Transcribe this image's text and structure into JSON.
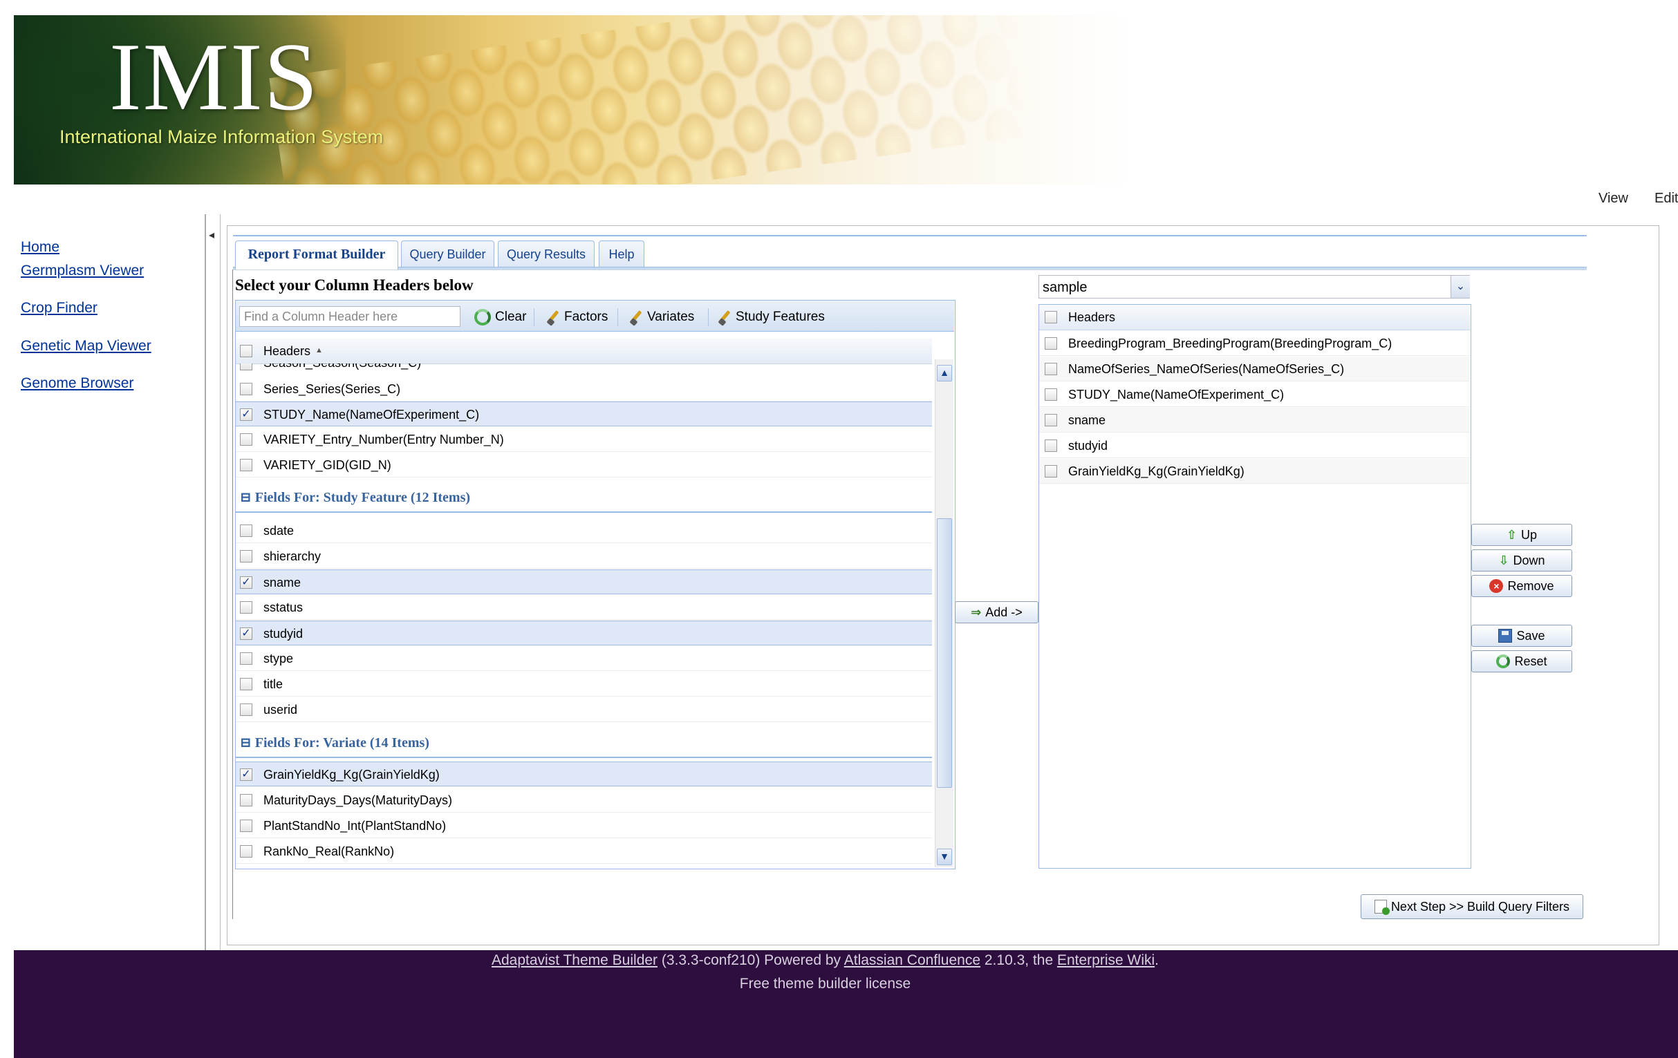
{
  "banner": {
    "title": "IMIS",
    "subtitle": "International Maize Information System"
  },
  "top_links": {
    "view": "View",
    "edit": "Edit"
  },
  "sidebar": {
    "items": [
      {
        "label": "Home"
      },
      {
        "label": "Germplasm Viewer"
      },
      {
        "label": "Crop Finder"
      },
      {
        "label": "Genetic Map Viewer"
      },
      {
        "label": "Genome Browser"
      }
    ]
  },
  "tabs": [
    {
      "label": "Report Format Builder",
      "active": true
    },
    {
      "label": "Query Builder",
      "active": false
    },
    {
      "label": "Query Results",
      "active": false
    },
    {
      "label": "Help",
      "active": false
    }
  ],
  "section_title": "Select your Column Headers below",
  "left_toolbar": {
    "search_placeholder": "Find a Column Header here",
    "clear": "Clear",
    "factors": "Factors",
    "variates": "Variates",
    "study_features": "Study Features"
  },
  "left_grid": {
    "header": "Headers",
    "sort_indicator": "▲",
    "partial_row": "Season_Season(Season_C)",
    "rows_top": [
      {
        "label": "Series_Series(Series_C)",
        "checked": false
      },
      {
        "label": "STUDY_Name(NameOfExperiment_C)",
        "checked": true
      },
      {
        "label": "VARIETY_Entry_Number(Entry Number_N)",
        "checked": false
      },
      {
        "label": "VARIETY_GID(GID_N)",
        "checked": false
      }
    ],
    "group_study": {
      "title": "Fields For: Study Feature (12 Items)",
      "rows": [
        {
          "label": "sdate",
          "checked": false
        },
        {
          "label": "shierarchy",
          "checked": false
        },
        {
          "label": "sname",
          "checked": true
        },
        {
          "label": "sstatus",
          "checked": false
        },
        {
          "label": "studyid",
          "checked": true
        },
        {
          "label": "stype",
          "checked": false
        },
        {
          "label": "title",
          "checked": false
        },
        {
          "label": "userid",
          "checked": false
        }
      ]
    },
    "group_variate": {
      "title": "Fields For: Variate (14 Items)",
      "rows": [
        {
          "label": "GrainYieldKg_Kg(GrainYieldKg)",
          "checked": true
        },
        {
          "label": "MaturityDays_Days(MaturityDays)",
          "checked": false
        },
        {
          "label": "PlantStandNo_Int(PlantStandNo)",
          "checked": false
        },
        {
          "label": "RankNo_Real(RankNo)",
          "checked": false
        }
      ]
    },
    "group_toggle": "⊟"
  },
  "add_button": "Add ->",
  "right_panel": {
    "combo_value": "sample",
    "header": "Headers",
    "rows": [
      {
        "label": "BreedingProgram_BreedingProgram(BreedingProgram_C)"
      },
      {
        "label": "NameOfSeries_NameOfSeries(NameOfSeries_C)"
      },
      {
        "label": "STUDY_Name(NameOfExperiment_C)"
      },
      {
        "label": "sname"
      },
      {
        "label": "studyid"
      },
      {
        "label": "GrainYieldKg_Kg(GrainYieldKg)"
      }
    ]
  },
  "side_buttons": {
    "up": "Up",
    "down": "Down",
    "remove": "Remove",
    "save": "Save",
    "reset": "Reset"
  },
  "next_button": "Next Step >> Build Query Filters",
  "footer": {
    "theme_builder": "Adaptavist Theme Builder",
    "version": "(3.3.3-conf210) Powered by",
    "confluence": "Atlassian Confluence",
    "confluence_version": "2.10.3, the",
    "enterprise_wiki": "Enterprise Wiki",
    "period": ".",
    "license": "Free theme builder license"
  },
  "colors": {
    "footer_bg": "#2d0e3e",
    "tab_text": "#15428b",
    "group_header": "#3764a0",
    "link": "#003399"
  }
}
